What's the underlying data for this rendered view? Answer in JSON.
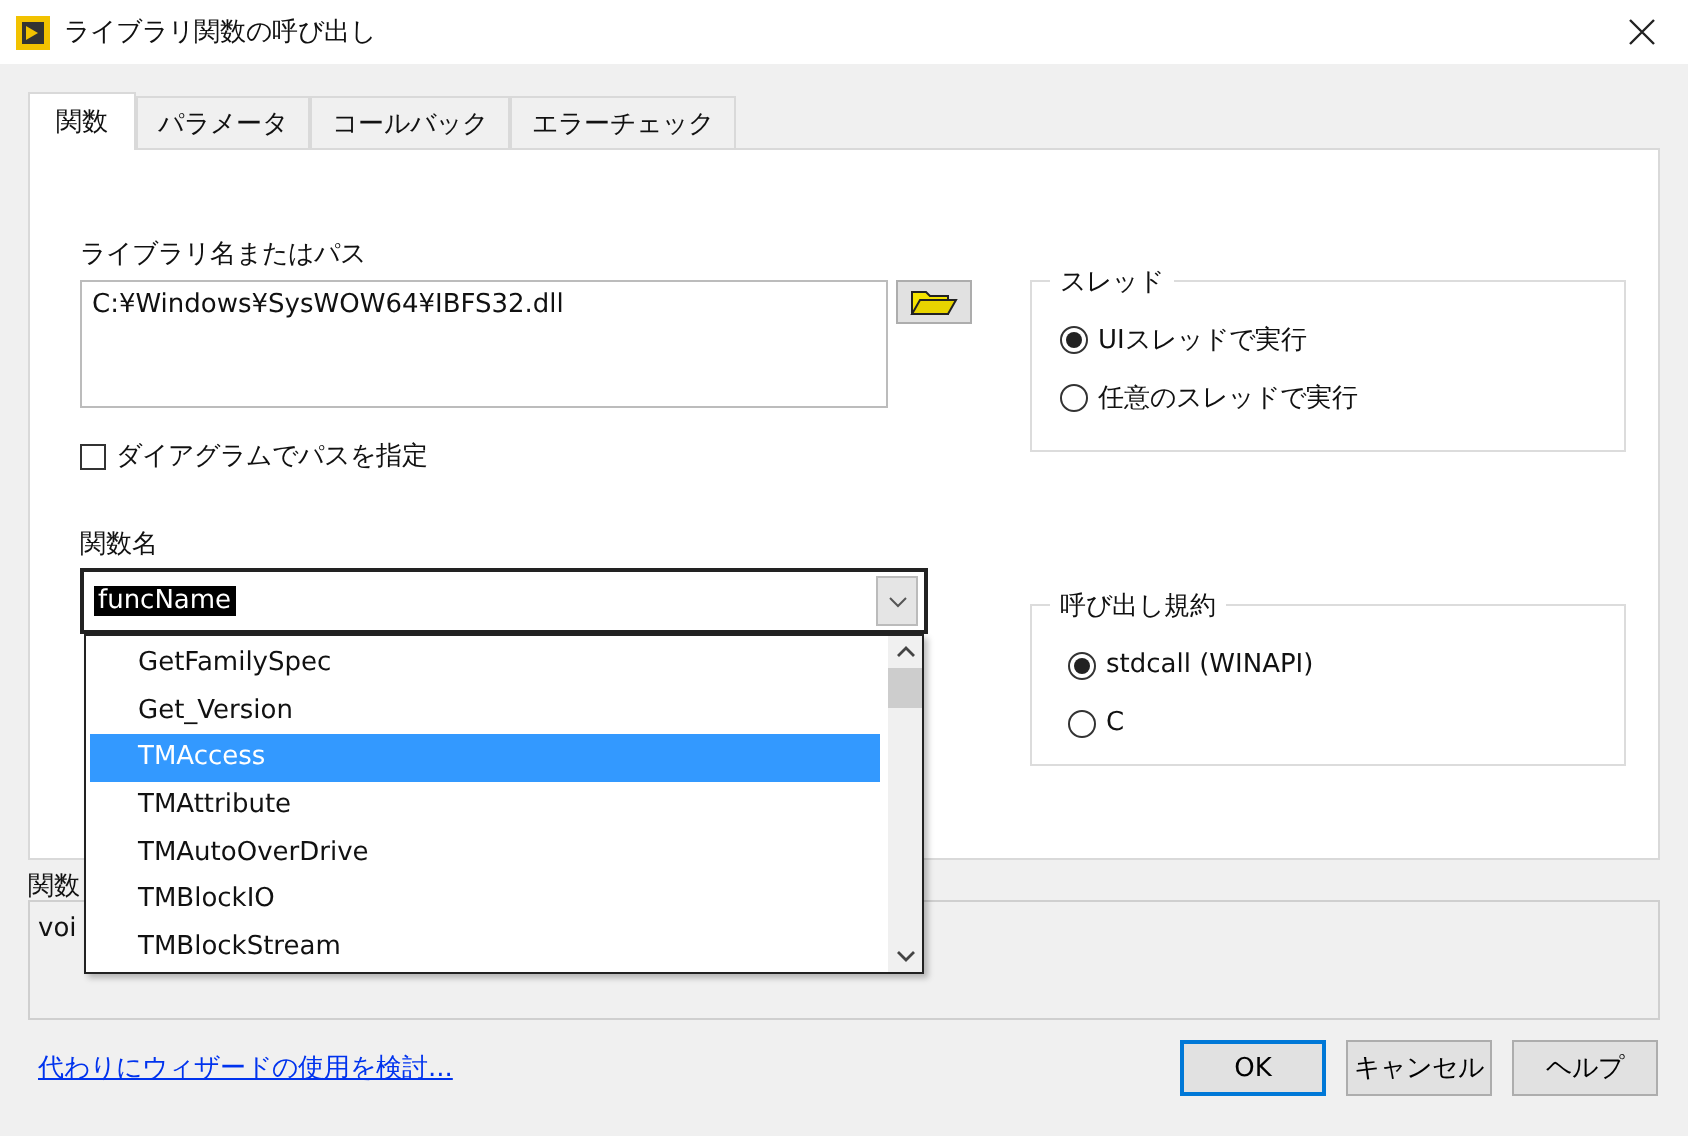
{
  "window": {
    "title": "ライブラリ関数の呼び出し"
  },
  "tabs": [
    {
      "label": "関数",
      "selected": true
    },
    {
      "label": "パラメータ",
      "selected": false
    },
    {
      "label": "コールバック",
      "selected": false
    },
    {
      "label": "エラーチェック",
      "selected": false
    }
  ],
  "library": {
    "label": "ライブラリ名またはパス",
    "value": "C:¥Windows¥SysWOW64¥IBFS32.dll"
  },
  "path_on_diagram": {
    "label": "ダイアグラムでパスを指定",
    "checked": false
  },
  "function_name": {
    "label": "関数名",
    "value": "funcName",
    "expanded": true,
    "items": [
      {
        "label": "GetFamilySpec",
        "selected": false
      },
      {
        "label": "Get_Version",
        "selected": false
      },
      {
        "label": "TMAccess",
        "selected": true
      },
      {
        "label": "TMAttribute",
        "selected": false
      },
      {
        "label": "TMAutoOverDrive",
        "selected": false
      },
      {
        "label": "TMBlockIO",
        "selected": false
      },
      {
        "label": "TMBlockStream",
        "selected": false
      }
    ]
  },
  "groups": [
    {
      "title": "スレッド",
      "options": [
        {
          "label": "UIスレッドで実行",
          "selected": true
        },
        {
          "label": "任意のスレッドで実行",
          "selected": false
        }
      ]
    },
    {
      "title": "呼び出し規約",
      "options": [
        {
          "label": "stdcall (WINAPI)",
          "selected": true
        },
        {
          "label": "C",
          "selected": false
        }
      ]
    }
  ],
  "prototype": {
    "label": "関数",
    "value": "voi"
  },
  "link": "代わりにウィザードの使用を検討...",
  "buttons": [
    {
      "label": "OK",
      "default": true
    },
    {
      "label": "キャンセル",
      "default": false
    },
    {
      "label": "ヘルプ",
      "default": false
    }
  ]
}
